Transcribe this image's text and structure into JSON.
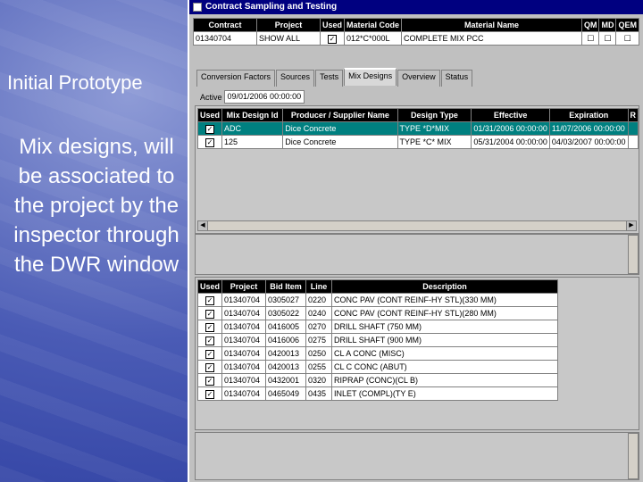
{
  "slide": {
    "title": "Initial Prototype",
    "body": "Mix designs, will be associated to the project by the inspector through the DWR window"
  },
  "window": {
    "title": "Contract Sampling and Testing",
    "header_columns": [
      "Contract",
      "Project",
      "Used",
      "Material Code",
      "Material Name",
      "QM",
      "MD",
      "QEM"
    ],
    "header_row": {
      "contract": "01340704",
      "project": "SHOW ALL",
      "used": "✓",
      "material_code": "012*C*000L",
      "material_name": "COMPLETE MIX PCC",
      "qm": "☐",
      "md": "☐",
      "qem": "☐"
    }
  },
  "tabs": [
    "Conversion Factors",
    "Sources",
    "Tests",
    "Mix Designs",
    "Overview",
    "Status"
  ],
  "active_tab": "Mix Designs",
  "active_label": "Active",
  "active_date": "09/01/2006 00:00:00",
  "mix_table": {
    "columns": [
      "Used",
      "Mix Design Id",
      "Producer / Supplier Name",
      "Design Type",
      "Effective",
      "Expiration",
      "R"
    ],
    "rows": [
      {
        "used": "✓",
        "id": "ADC",
        "producer": "Dice Concrete",
        "type": "TYPE *D*MIX",
        "effective": "01/31/2006 00:00:00",
        "expiration": "11/07/2006 00:00:00"
      },
      {
        "used": "✓",
        "id": "125",
        "producer": "Dice Concrete",
        "type": "TYPE *C* MIX",
        "effective": "05/31/2004 00:00:00",
        "expiration": "04/03/2007 00:00:00"
      }
    ]
  },
  "items_table": {
    "columns": [
      "Used",
      "Project",
      "Bid Item",
      "Line",
      "Description"
    ],
    "rows": [
      {
        "used": "✓",
        "project": "01340704",
        "bid": "0305027",
        "line": "0220",
        "desc": "CONC PAV (CONT REINF-HY STL)(330 MM)"
      },
      {
        "used": "✓",
        "project": "01340704",
        "bid": "0305022",
        "line": "0240",
        "desc": "CONC PAV (CONT REINF-HY STL)(280 MM)"
      },
      {
        "used": "✓",
        "project": "01340704",
        "bid": "0416005",
        "line": "0270",
        "desc": "DRILL SHAFT (750 MM)"
      },
      {
        "used": "✓",
        "project": "01340704",
        "bid": "0416006",
        "line": "0275",
        "desc": "DRILL SHAFT (900 MM)"
      },
      {
        "used": "✓",
        "project": "01340704",
        "bid": "0420013",
        "line": "0250",
        "desc": "CL A CONC (MISC)"
      },
      {
        "used": "✓",
        "project": "01340704",
        "bid": "0420013",
        "line": "0255",
        "desc": "CL C CONC (ABUT)"
      },
      {
        "used": "✓",
        "project": "01340704",
        "bid": "0432001",
        "line": "0320",
        "desc": "RIPRAP (CONC)(CL B)"
      },
      {
        "used": "✓",
        "project": "01340704",
        "bid": "0465049",
        "line": "0435",
        "desc": "INLET (COMPL)(TY E)"
      }
    ]
  }
}
